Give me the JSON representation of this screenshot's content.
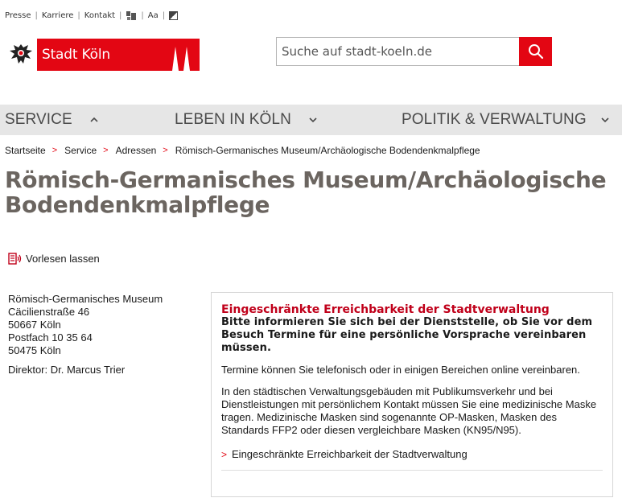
{
  "meta_nav": {
    "items": [
      "Presse",
      "Karriere",
      "Kontakt"
    ],
    "sign_language_icon": "sign-language-icon",
    "font_size_label": "Aa",
    "contrast_icon": "contrast-icon"
  },
  "logo": {
    "name": "Stadt Köln",
    "brand_color": "#e30613"
  },
  "search": {
    "placeholder": "Suche auf stadt-koeln.de",
    "button_icon": "search-icon"
  },
  "main_nav": [
    {
      "label": "Service",
      "icon": "chevron-up-icon"
    },
    {
      "label": "Leben in Köln",
      "icon": "chevron-down-icon"
    },
    {
      "label": "Politik & Verwaltung",
      "icon": "chevron-down-icon"
    }
  ],
  "breadcrumb": [
    "Startseite",
    "Service",
    "Adressen",
    "Römisch-Germanisches Museum/Archäologische Bodendenkmalpflege"
  ],
  "page_title": "Römisch-Germanisches Museum/Archäologische Bodendenkmalpflege",
  "read_aloud": "Vorlesen lassen",
  "address": {
    "lines": [
      "Römisch-Germanisches Museum",
      "Cäcilienstraße 46",
      "50667 Köln",
      "Postfach 10 35 64",
      "50475 Köln"
    ],
    "director": "Direktor: Dr. Marcus Trier"
  },
  "notice": {
    "heading": "Eingeschränkte Erreichbarkeit der Stadtverwaltung",
    "bold_text": "Bitte informieren Sie sich bei der Dienststelle, ob Sie vor dem Besuch Termine für eine persönliche Vorsprache vereinbaren müssen.",
    "paragraph1": "Termine können Sie telefonisch oder in einigen Bereichen online vereinbaren.",
    "paragraph2": "In den städtischen Verwaltungsgebäuden mit Publikumsverkehr und bei Dienstleistungen mit persönlichem Kontakt müssen Sie eine medizinische Maske tragen. Medizinische Masken sind sogenannte OP-Masken, Masken des Standards FFP2 oder diesen vergleichbare Masken (KN95/N95).",
    "link": "Eingeschränkte Erreichbarkeit der Stadtverwaltung"
  }
}
